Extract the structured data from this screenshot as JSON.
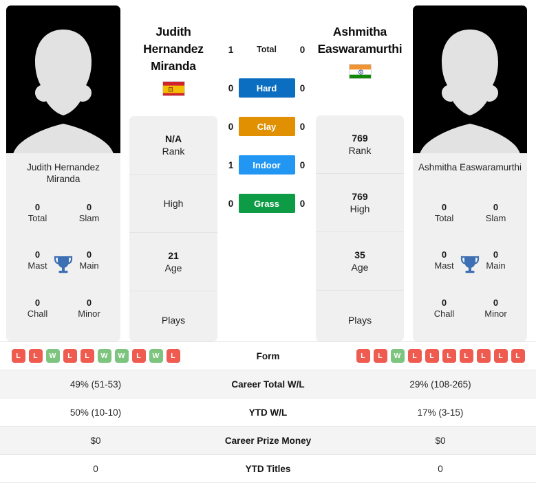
{
  "players": {
    "left": {
      "display_name": "Judith\nHernandez\nMiranda",
      "name_lines": [
        "Judith",
        "Hernandez",
        "Miranda"
      ],
      "caption_name": "Judith Hernandez Miranda",
      "country": "Spain",
      "flag": "es-flag",
      "stats_card": [
        {
          "value": "N/A",
          "label": "Rank"
        },
        {
          "value": "",
          "label": "High"
        },
        {
          "value": "21",
          "label": "Age"
        },
        {
          "value": "",
          "label": "Plays"
        }
      ],
      "titles": [
        {
          "value": "0",
          "label": "Total"
        },
        {
          "value": "0",
          "label": "Slam"
        },
        {
          "value": "0",
          "label": "Mast"
        },
        {
          "value": "0",
          "label": "Main"
        },
        {
          "value": "0",
          "label": "Chall"
        },
        {
          "value": "0",
          "label": "Minor"
        }
      ],
      "form": [
        "L",
        "L",
        "W",
        "L",
        "L",
        "W",
        "W",
        "L",
        "W",
        "L"
      ],
      "career_total_wl": "49% (51-53)",
      "ytd_wl": "50% (10-10)",
      "career_prize_money": "$0",
      "ytd_titles": "0"
    },
    "right": {
      "display_name": "Ashmitha\nEaswaramurthi",
      "name_lines": [
        "Ashmitha",
        "Easwaramurthi"
      ],
      "caption_name": "Ashmitha Easwaramurthi",
      "country": "India",
      "flag": "in-flag",
      "stats_card": [
        {
          "value": "769",
          "label": "Rank"
        },
        {
          "value": "769",
          "label": "High"
        },
        {
          "value": "35",
          "label": "Age"
        },
        {
          "value": "",
          "label": "Plays"
        }
      ],
      "titles": [
        {
          "value": "0",
          "label": "Total"
        },
        {
          "value": "0",
          "label": "Slam"
        },
        {
          "value": "0",
          "label": "Mast"
        },
        {
          "value": "0",
          "label": "Main"
        },
        {
          "value": "0",
          "label": "Chall"
        },
        {
          "value": "0",
          "label": "Minor"
        }
      ],
      "form": [
        "L",
        "L",
        "W",
        "L",
        "L",
        "L",
        "L",
        "L",
        "L",
        "L"
      ],
      "career_total_wl": "29% (108-265)",
      "ytd_wl": "17% (3-15)",
      "career_prize_money": "$0",
      "ytd_titles": "0"
    }
  },
  "head_to_head": [
    {
      "label": "Total",
      "left": "1",
      "right": "0",
      "color": ""
    },
    {
      "label": "Hard",
      "left": "0",
      "right": "0",
      "color": "#0b6ec1"
    },
    {
      "label": "Clay",
      "left": "0",
      "right": "0",
      "color": "#e09000"
    },
    {
      "label": "Indoor",
      "left": "1",
      "right": "0",
      "color": "#2196f3"
    },
    {
      "label": "Grass",
      "left": "0",
      "right": "0",
      "color": "#0e9b45"
    }
  ],
  "comparison_rows": [
    {
      "label": "Form",
      "left": "",
      "right": ""
    },
    {
      "label": "Career Total W/L",
      "left": "49% (51-53)",
      "right": "29% (108-265)"
    },
    {
      "label": "YTD W/L",
      "left": "50% (10-10)",
      "right": "17% (3-15)"
    },
    {
      "label": "Career Prize Money",
      "left": "$0",
      "right": "$0"
    },
    {
      "label": "YTD Titles",
      "left": "0",
      "right": "0"
    }
  ],
  "colors": {
    "hard": "#0b6ec1",
    "clay": "#e09000",
    "indoor": "#2196f3",
    "grass": "#0e9b45",
    "win_badge": "#7dc47f",
    "loss_badge": "#f05b4f",
    "panel_bg": "#f0f0f0",
    "trophy": "#3d6fb4"
  }
}
